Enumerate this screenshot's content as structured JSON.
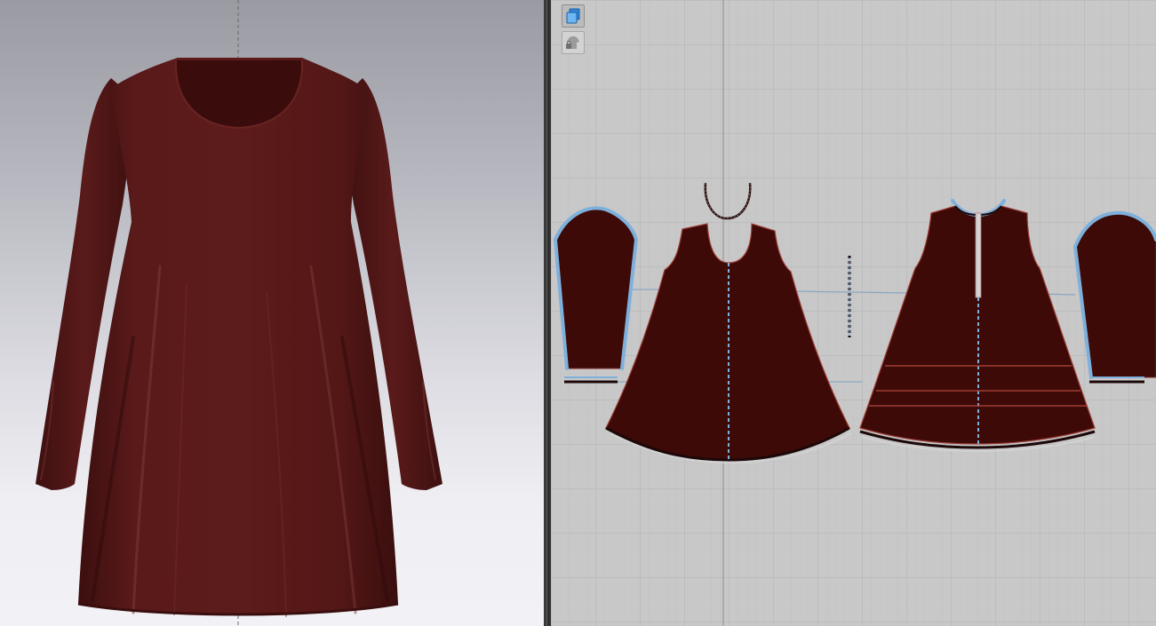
{
  "viewport_3d": {
    "background": "gradient-light-gray",
    "garment_color": "#5a1a1a",
    "garment": "long-sleeve-dress"
  },
  "viewport_2d": {
    "background": "#c8c8c8",
    "pattern_fill": "#3d0a07",
    "seam_highlight": "#7eb0dc",
    "toolbar": {
      "items": [
        {
          "icon": "blue-pattern-icon",
          "active": true
        },
        {
          "icon": "locked-avatar-icon",
          "active": false
        }
      ]
    },
    "pieces": [
      "left-sleeve",
      "front-bodice",
      "neckline-binding",
      "placket-strip",
      "back-bodice",
      "right-sleeve"
    ]
  }
}
